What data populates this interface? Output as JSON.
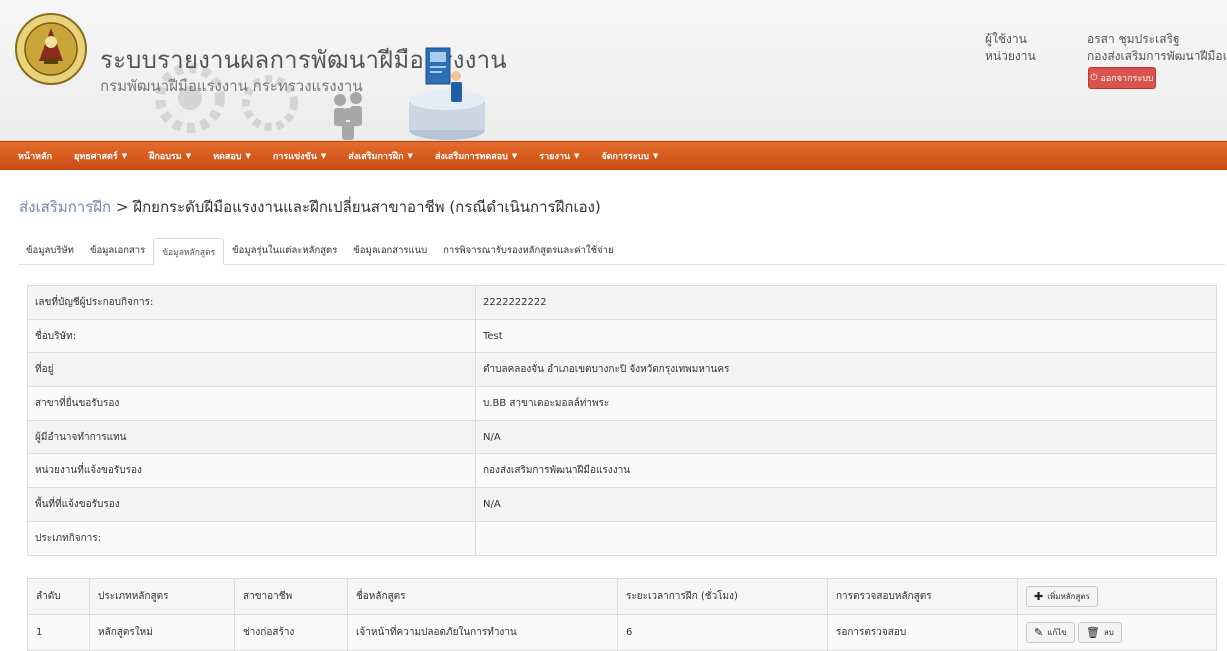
{
  "header": {
    "title": "ระบบรายงานผลการพัฒนาฝีมือแรงงาน",
    "subtitle": "กรมพัฒนาฝีมือแรงงาน กระทรวงแรงงาน",
    "user_label": "ผู้ใช้งาน",
    "unit_label": "หน่วยงาน",
    "user_name": "อรสา ชุมประเสริฐ",
    "unit_name": "กองส่งเสริมการพัฒนาฝีมือแรงงาน",
    "logout_label": "ออกจากระบบ"
  },
  "nav": {
    "items": [
      {
        "label": "หน้าหลัก",
        "dropdown": false
      },
      {
        "label": "ยุทธศาสตร์",
        "dropdown": true
      },
      {
        "label": "ฝึกอบรม",
        "dropdown": true
      },
      {
        "label": "ทดสอบ",
        "dropdown": true
      },
      {
        "label": "การแข่งขัน",
        "dropdown": true
      },
      {
        "label": "ส่งเสริมการฝึก",
        "dropdown": true
      },
      {
        "label": "ส่งเสริมการทดสอบ",
        "dropdown": true
      },
      {
        "label": "รายงาน",
        "dropdown": true
      },
      {
        "label": "จัดการระบบ",
        "dropdown": true
      }
    ]
  },
  "breadcrumb": {
    "parent": "ส่งเสริมการฝึก",
    "separator": ">",
    "current": "ฝึกยกระดับฝีมือแรงงานและฝึกเปลี่ยนสาขาอาชีพ (กรณีดำเนินการฝึกเอง)"
  },
  "tabs": [
    {
      "label": "ข้อมูลบริษัท",
      "active": false
    },
    {
      "label": "ข้อมูลเอกสาร",
      "active": false
    },
    {
      "label": "ข้อมูลหลักสูตร",
      "active": true
    },
    {
      "label": "ข้อมูลรุ่นในแต่ละหลักสูตร",
      "active": false
    },
    {
      "label": "ข้อมูลเอกสารแนบ",
      "active": false
    },
    {
      "label": "การพิจารณารับรองหลักสูตรและค่าใช้จ่าย",
      "active": false
    }
  ],
  "info_rows": [
    {
      "label": "เลขที่บัญชีผู้ประกอบกิจการ:",
      "value": "2222222222"
    },
    {
      "label": "ชื่อบริษัท:",
      "value": "Test"
    },
    {
      "label": "ที่อยู่",
      "value": "ตำบลคลองจั่น อำเภอเขตบางกะปิ จังหวัดกรุงเทพมหานคร"
    },
    {
      "label": "สาขาที่ยื่นขอรับรอง",
      "value": "บ.BB สาขาเดอะมอลล์ท่าพระ"
    },
    {
      "label": "ผู้มีอำนาจทำการแทน",
      "value": "N/A"
    },
    {
      "label": "หน่วยงานที่แจ้งขอรับรอง",
      "value": "กองส่งเสริมการพัฒนาฝีมือแรงงาน"
    },
    {
      "label": "พื้นที่ที่แจ้งขอรับรอง",
      "value": "N/A"
    },
    {
      "label": "ประเภทกิจการ:",
      "value": ""
    }
  ],
  "course_table": {
    "headers": [
      "ลำดับ",
      "ประเภทหลักสูตร",
      "สาขาอาชีพ",
      "ชื่อหลักสูตร",
      "ระยะเวลาการฝึก (ชั่วโมง)",
      "การตรวจสอบหลักสูตร"
    ],
    "add_button": "เพิ่มหลักสูตร",
    "rows": [
      {
        "no": "1",
        "type": "หลักสูตรใหม่",
        "branch": "ช่างก่อสร้าง",
        "name": "เจ้าหน้าที่ความปลอดภัยในการทำงาน",
        "hours": "6",
        "status": "รอการตรวจสอบ",
        "edit": "แก้ไข",
        "delete": "ลบ"
      }
    ]
  },
  "colors": {
    "nav_bg": "#d9591c",
    "logout_bg": "#d9534f",
    "link": "#6b8bb6"
  }
}
